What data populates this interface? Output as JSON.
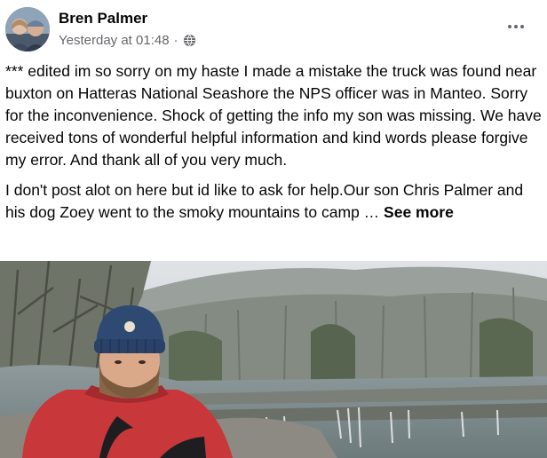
{
  "post": {
    "author": "Bren Palmer",
    "timestamp": "Yesterday at 01:48",
    "separator": "·",
    "audience_icon": "globe-icon",
    "more_icon": "more-options-icon",
    "paragraph_1": "*** edited im so sorry on my haste I made a mistake the truck was found near buxton on Hatteras National Seashore  the NPS  officer was in Manteo. Sorry for the inconvenience. Shock of getting the info my son was missing. We have received tons of wonderful helpful information and kind words please forgive my error. And thank all of you very much.",
    "paragraph_2": "I don't post alot on here but id like to ask for help.Our son Chris Palmer and his dog Zoey went to the smoky mountains to camp …",
    "see_more": "See more"
  },
  "colors": {
    "text": "#050505",
    "secondary_text": "#65676b",
    "jacket_red": "#c8373a",
    "beanie_blue": "#2e4a72"
  }
}
